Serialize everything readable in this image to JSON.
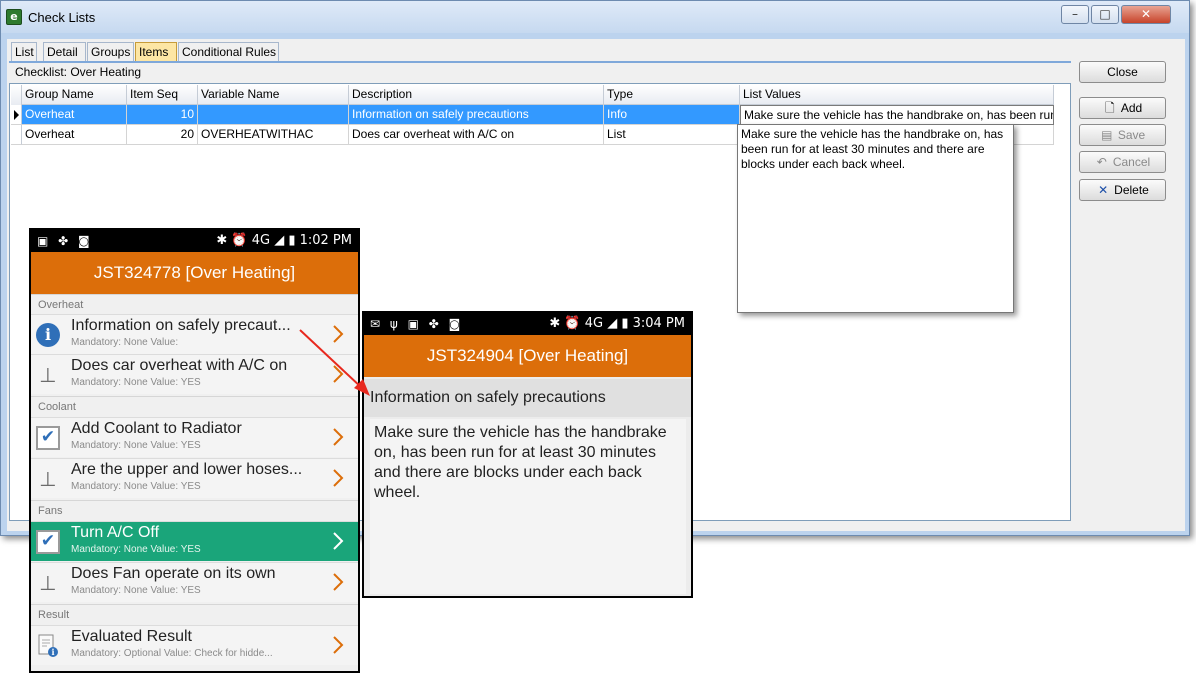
{
  "window": {
    "title": "Check Lists",
    "buttons": {
      "minimize": "–",
      "maximize": "□",
      "close": "✕"
    }
  },
  "tabs": [
    {
      "label": "List",
      "active": false
    },
    {
      "label": "Detail",
      "active": false
    },
    {
      "label": "Groups",
      "active": false
    },
    {
      "label": "Items",
      "active": true
    },
    {
      "label": "Conditional Rules",
      "active": false
    }
  ],
  "checklist_label": "Checklist: Over Heating",
  "grid": {
    "columns": [
      "Group Name",
      "Item Seq",
      "Variable Name",
      "Description",
      "Type",
      "List Values"
    ],
    "rows": [
      {
        "group": "Overheat",
        "seq": "10",
        "variable": "",
        "description": "Information on safely precautions",
        "type": "Info",
        "list_values": "Make sure the vehicle has the handbrake on, has been run"
      },
      {
        "group": "Overheat",
        "seq": "20",
        "variable": "OVERHEATWITHAC",
        "description": "Does car overheat with A/C on",
        "type": "List",
        "list_values": ""
      }
    ],
    "popup_text": "Make sure the vehicle has the handbrake on, has been run for at least 30 minutes and there are blocks under each back wheel."
  },
  "side_buttons": {
    "close": "Close",
    "add": "Add",
    "save": "Save",
    "cancel": "Cancel",
    "delete": "Delete"
  },
  "phone1": {
    "status_icons": "▣ ✤ ◙",
    "status_right": "✱ ⏰ 4G ◢ ▮ 1:02 PM",
    "title": "JST324778 [Over Heating]",
    "sections": {
      "overheat": "Overheat",
      "coolant": "Coolant",
      "fans": "Fans",
      "result": "Result"
    },
    "items": [
      {
        "title": "Information on safely precaut...",
        "sub": "Mandatory: None Value:",
        "icon": "info-icon"
      },
      {
        "title": "Does car overheat with A/C on",
        "sub": "Mandatory: None Value: YES",
        "icon": "pin-icon"
      },
      {
        "title": "Add Coolant to Radiator",
        "sub": "Mandatory: None Value: YES",
        "icon": "checkbox-icon"
      },
      {
        "title": "Are the upper and lower hoses...",
        "sub": "Mandatory: None Value: YES",
        "icon": "pin-icon"
      },
      {
        "title": "Turn A/C Off",
        "sub": "Mandatory: None Value: YES",
        "icon": "checkbox-icon"
      },
      {
        "title": "Does Fan operate on its own",
        "sub": "Mandatory: None Value: YES",
        "icon": "pin-icon"
      },
      {
        "title": "Evaluated Result",
        "sub": "Mandatory: Optional Value: Check for hidde...",
        "icon": "document-info-icon"
      }
    ]
  },
  "phone2": {
    "status_icons": "✉ ψ ▣ ✤ ◙",
    "status_right": "✱ ⏰ 4G ◢ ▮ 3:04 PM",
    "title": "JST324904 [Over Heating]",
    "heading": "Information on safely precautions",
    "body": "Make sure the vehicle has the handbrake on, has been run for at least 30 minutes and there are blocks under each back wheel."
  },
  "colors": {
    "accent_orange": "#dc6e0a",
    "selection_blue": "#3399ff",
    "done_green": "#1aa57a",
    "arrow_red": "#e8281e"
  }
}
